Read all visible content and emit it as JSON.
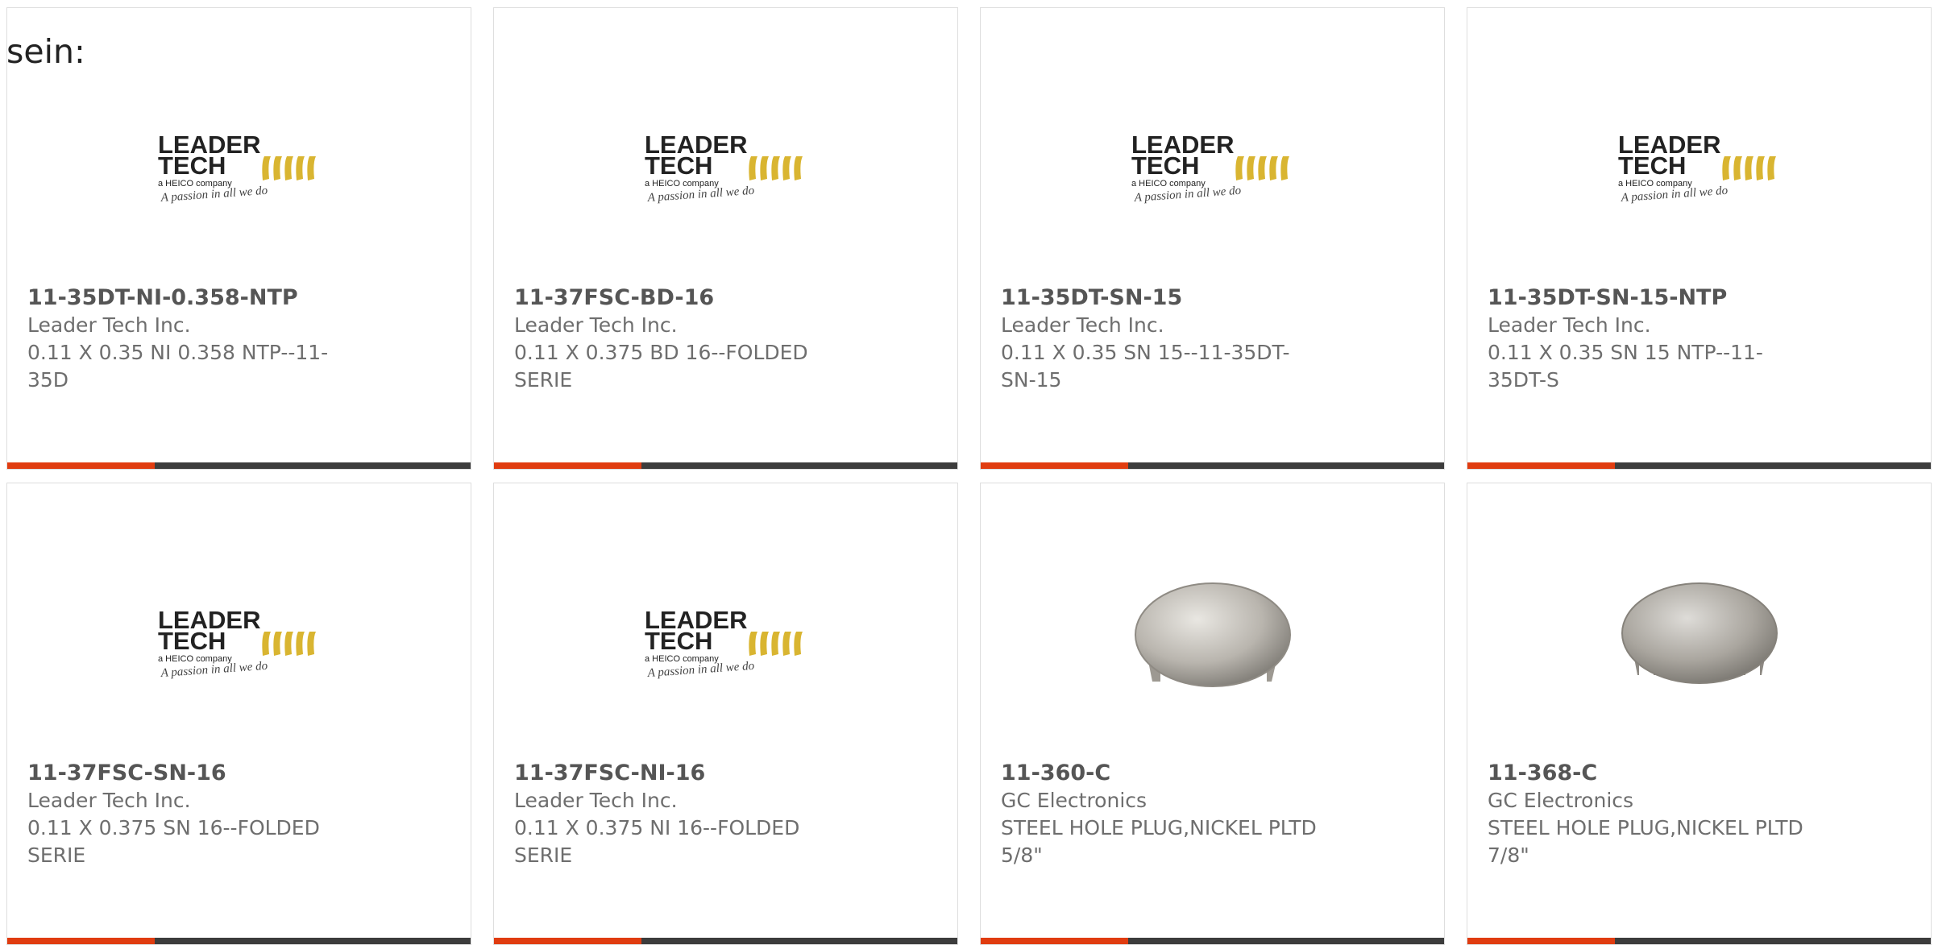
{
  "lead_text": "sein:",
  "brand_color": "#e03c10",
  "bar_color": "#3c3c3c",
  "products": [
    {
      "part": "11-35DT-NI-0.358-NTP",
      "manufacturer": "Leader Tech Inc.",
      "description": "0.11 X 0.35 NI 0.358 NTP--11-35D",
      "image": "leader-tech-logo",
      "logo": {
        "line1": "LEADER",
        "line2": "TECH",
        "sub": "a HEICO company",
        "tag": "A passion in all we do"
      }
    },
    {
      "part": "11-37FSC-BD-16",
      "manufacturer": "Leader Tech Inc.",
      "description": "0.11 X 0.375 BD 16--FOLDED SERIE",
      "image": "leader-tech-logo",
      "logo": {
        "line1": "LEADER",
        "line2": "TECH",
        "sub": "a HEICO company",
        "tag": "A passion in all we do"
      }
    },
    {
      "part": "11-35DT-SN-15",
      "manufacturer": "Leader Tech Inc.",
      "description": "0.11 X 0.35 SN 15--11-35DT-SN-15",
      "image": "leader-tech-logo",
      "logo": {
        "line1": "LEADER",
        "line2": "TECH",
        "sub": "a HEICO company",
        "tag": "A passion in all we do"
      }
    },
    {
      "part": "11-35DT-SN-15-NTP",
      "manufacturer": "Leader Tech Inc.",
      "description": "0.11 X 0.35 SN 15 NTP--11-35DT-S",
      "image": "leader-tech-logo",
      "logo": {
        "line1": "LEADER",
        "line2": "TECH",
        "sub": "a HEICO company",
        "tag": "A passion in all we do"
      }
    },
    {
      "part": "11-37FSC-SN-16",
      "manufacturer": "Leader Tech Inc.",
      "description": "0.11 X 0.375 SN 16--FOLDED SERIE",
      "image": "leader-tech-logo",
      "logo": {
        "line1": "LEADER",
        "line2": "TECH",
        "sub": "a HEICO company",
        "tag": "A passion in all we do"
      }
    },
    {
      "part": "11-37FSC-NI-16",
      "manufacturer": "Leader Tech Inc.",
      "description": "0.11 X 0.375 NI 16--FOLDED SERIE",
      "image": "leader-tech-logo",
      "logo": {
        "line1": "LEADER",
        "line2": "TECH",
        "sub": "a HEICO company",
        "tag": "A passion in all we do"
      }
    },
    {
      "part": "11-360-C",
      "manufacturer": "GC Electronics",
      "description": "STEEL HOLE PLUG,NICKEL PLTD 5/8\"",
      "image": "hole-plug-photo"
    },
    {
      "part": "11-368-C",
      "manufacturer": "GC Electronics",
      "description": "STEEL HOLE PLUG,NICKEL PLTD 7/8\"",
      "image": "hole-plug-photo"
    }
  ]
}
